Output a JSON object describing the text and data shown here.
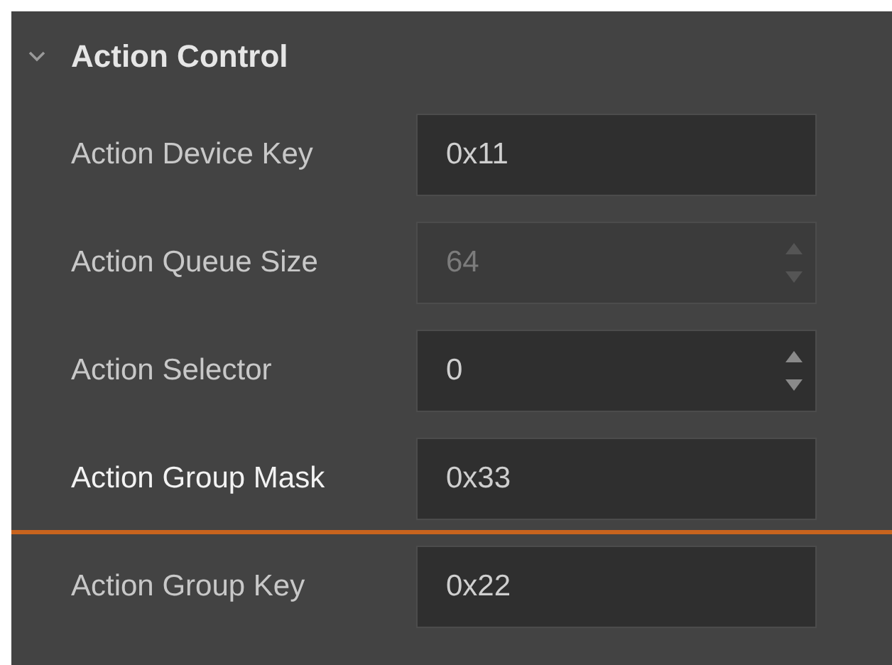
{
  "section": {
    "title": "Action Control",
    "expanded": true
  },
  "rows": [
    {
      "label": "Action Device Key",
      "kind": "text",
      "value": "0x11",
      "disabled": false,
      "selected": false
    },
    {
      "label": "Action Queue Size",
      "kind": "spin",
      "value": "64",
      "disabled": true,
      "selected": false
    },
    {
      "label": "Action Selector",
      "kind": "spin",
      "value": "0",
      "disabled": false,
      "selected": false
    },
    {
      "label": "Action Group Mask",
      "kind": "text",
      "value": "0x33",
      "disabled": false,
      "selected": true
    },
    {
      "label": "Action Group Key",
      "kind": "text",
      "value": "0x22",
      "disabled": false,
      "selected": false
    }
  ]
}
